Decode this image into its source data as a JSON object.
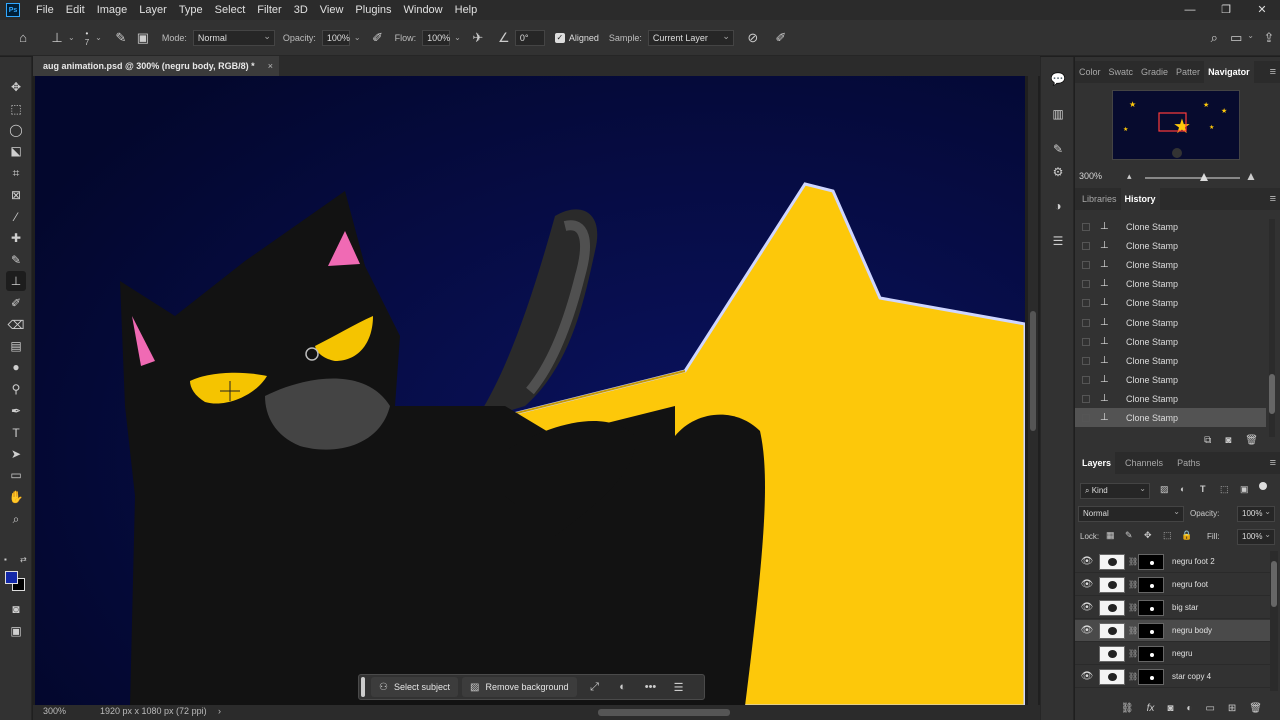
{
  "menubar": {
    "logo": "Ps",
    "items": [
      "File",
      "Edit",
      "Image",
      "Layer",
      "Type",
      "Select",
      "Filter",
      "3D",
      "View",
      "Plugins",
      "Window",
      "Help"
    ]
  },
  "options": {
    "brush_size": "7",
    "mode_label": "Mode:",
    "mode_value": "Normal",
    "opacity_label": "Opacity:",
    "opacity_value": "100%",
    "flow_label": "Flow:",
    "flow_value": "100%",
    "angle_value": "0°",
    "aligned_label": "Aligned",
    "aligned_checked": true,
    "sample_label": "Sample:",
    "sample_value": "Current Layer"
  },
  "document": {
    "tab_title": "aug animation.psd @ 300% (negru body, RGB/8) *",
    "tab_close": "×"
  },
  "status": {
    "zoom": "300%",
    "dimensions": "1920 px x 1080 px (72 ppi)",
    "arrow": "›"
  },
  "taskbar": {
    "select_subject": "Select subject",
    "remove_background": "Remove background"
  },
  "navigator_panel": {
    "tabs": [
      "Color",
      "Swatc",
      "Gradie",
      "Patter",
      "Navigator"
    ],
    "active_tab": "Navigator",
    "zoom": "300%"
  },
  "history_panel": {
    "tabs": [
      "Libraries",
      "History"
    ],
    "active_tab": "History",
    "items": [
      "Clone Stamp",
      "Clone Stamp",
      "Clone Stamp",
      "Clone Stamp",
      "Clone Stamp",
      "Clone Stamp",
      "Clone Stamp",
      "Clone Stamp",
      "Clone Stamp",
      "Clone Stamp",
      "Clone Stamp"
    ],
    "selected_index": 10
  },
  "layers_panel": {
    "tabs": [
      "Layers",
      "Channels",
      "Paths"
    ],
    "active_tab": "Layers",
    "filter_kind": "Kind",
    "blend_mode": "Normal",
    "opacity_label": "Opacity:",
    "opacity_value": "100%",
    "lock_label": "Lock:",
    "fill_label": "Fill:",
    "fill_value": "100%",
    "layers": [
      {
        "name": "negru foot 2",
        "visible": true
      },
      {
        "name": "negru foot",
        "visible": true
      },
      {
        "name": "big star",
        "visible": true
      },
      {
        "name": "negru body",
        "visible": true
      },
      {
        "name": "negru",
        "visible": false
      },
      {
        "name": "star copy 4",
        "visible": true
      }
    ],
    "selected_layer": "negru body"
  },
  "colors": {
    "foreground": "#1328a8",
    "background": "#000000",
    "canvas_bg": "#050a3a",
    "star": "#fdc80a",
    "cat": "#111111",
    "ear": "#f06ab4",
    "eye": "#f5c400"
  }
}
